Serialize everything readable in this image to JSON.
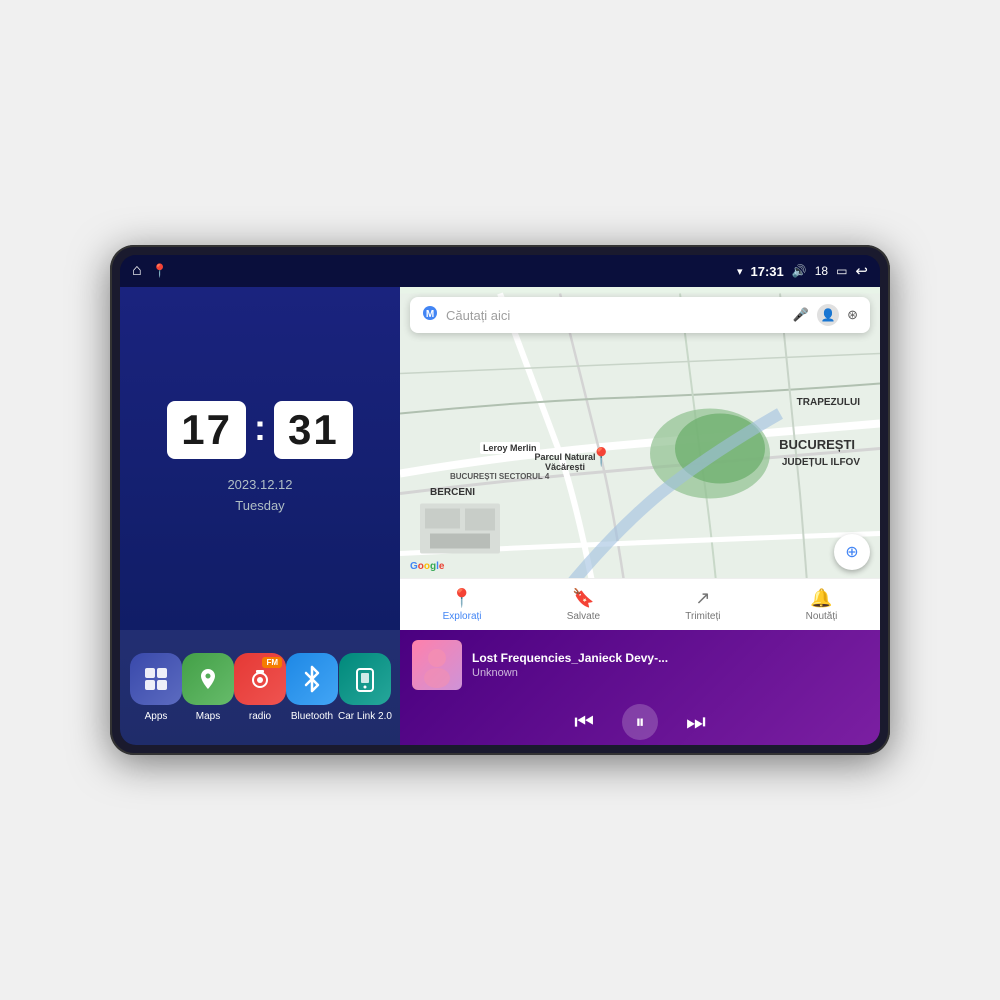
{
  "device": {
    "screen": {
      "status_bar": {
        "left_icons": [
          "home",
          "maps"
        ],
        "time": "17:31",
        "signal": "▾",
        "volume": "🔊",
        "volume_level": "18",
        "battery": "▭",
        "back": "↩"
      },
      "clock": {
        "hours": "17",
        "minutes": "31",
        "date": "2023.12.12",
        "day": "Tuesday"
      },
      "apps": [
        {
          "id": "apps",
          "label": "Apps",
          "icon": "⊞",
          "bg": "apps-bg"
        },
        {
          "id": "maps",
          "label": "Maps",
          "icon": "📍",
          "bg": "maps-bg"
        },
        {
          "id": "radio",
          "label": "radio",
          "icon": "📻",
          "bg": "radio-bg",
          "badge": "FM"
        },
        {
          "id": "bluetooth",
          "label": "Bluetooth",
          "icon": "⬡",
          "bg": "bluetooth-bg"
        },
        {
          "id": "carlink",
          "label": "Car Link 2.0",
          "icon": "📱",
          "bg": "carlink-bg"
        }
      ],
      "map": {
        "search_placeholder": "Căutați aici",
        "nav_items": [
          {
            "id": "explore",
            "label": "Explorați",
            "icon": "📍",
            "active": true
          },
          {
            "id": "saved",
            "label": "Salvate",
            "icon": "🔖",
            "active": false
          },
          {
            "id": "share",
            "label": "Trimiteți",
            "icon": "⊕",
            "active": false
          },
          {
            "id": "news",
            "label": "Noutăți",
            "icon": "🔔",
            "active": false
          }
        ],
        "labels": [
          "BUCUREȘTI",
          "JUDEȚUL ILFOV",
          "TRAPEZULUI",
          "BERCENI",
          "Leroy Merlin",
          "Parcul Natural Văcărești",
          "BUCUREȘTI SECTORUL 4"
        ]
      },
      "music": {
        "title": "Lost Frequencies_Janieck Devy-...",
        "artist": "Unknown",
        "controls": {
          "prev": "⏮",
          "play": "⏸",
          "next": "⏭"
        }
      }
    }
  }
}
